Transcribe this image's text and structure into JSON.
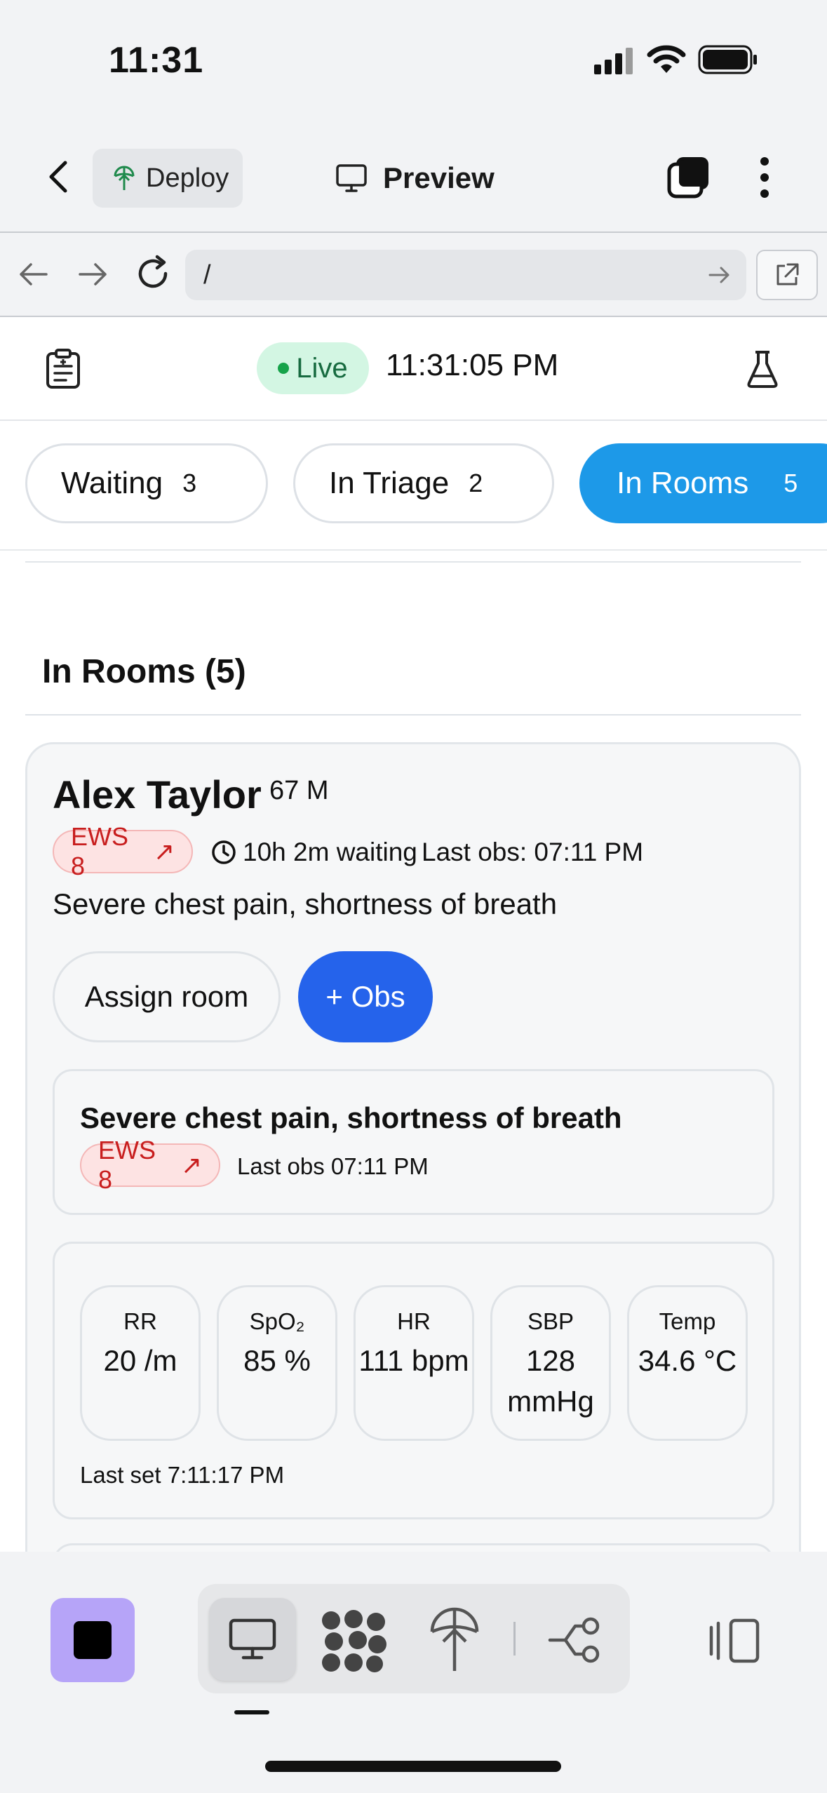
{
  "status_bar": {
    "time": "11:31"
  },
  "header": {
    "deploy_label": "Deploy",
    "preview_label": "Preview"
  },
  "url_bar": {
    "path": "/"
  },
  "app": {
    "live_label": "Live",
    "clock": "11:31:05 PM",
    "tabs": [
      {
        "label": "Waiting",
        "count": "3",
        "active": false
      },
      {
        "label": "In Triage",
        "count": "2",
        "active": false
      },
      {
        "label": "In Rooms",
        "count": "5",
        "active": true
      }
    ],
    "section_title": "In Rooms (5)",
    "patient": {
      "name": "Alex Taylor",
      "age_sex": "67 M",
      "ews": "EWS 8",
      "ews_arrow": "↗",
      "waiting": "10h 2m waiting",
      "last_obs": "Last obs: 07:11 PM",
      "complaint": "Severe chest pain, shortness of breath",
      "assign_room_label": "Assign room",
      "add_obs_label": "+ Obs",
      "summary": {
        "complaint": "Severe chest pain, shortness of breath",
        "ews": "EWS 8",
        "last_obs": "Last obs 07:11 PM"
      },
      "vitals": [
        {
          "label": "RR",
          "value": "20 /m"
        },
        {
          "label": "SpO₂",
          "value": "85 %"
        },
        {
          "label": "HR",
          "value": "111 bpm"
        },
        {
          "label": "SBP",
          "value": "128 mmHg"
        },
        {
          "label": "Temp",
          "value": "34.6 °C"
        }
      ],
      "last_set": "Last set 7:11:17 PM"
    }
  },
  "colors": {
    "accent_blue": "#1d99e8",
    "obs_button": "#2563eb",
    "ews_red": "#c81e1e",
    "live_green": "#16a34a",
    "stop_purple": "#b6a4f8"
  }
}
